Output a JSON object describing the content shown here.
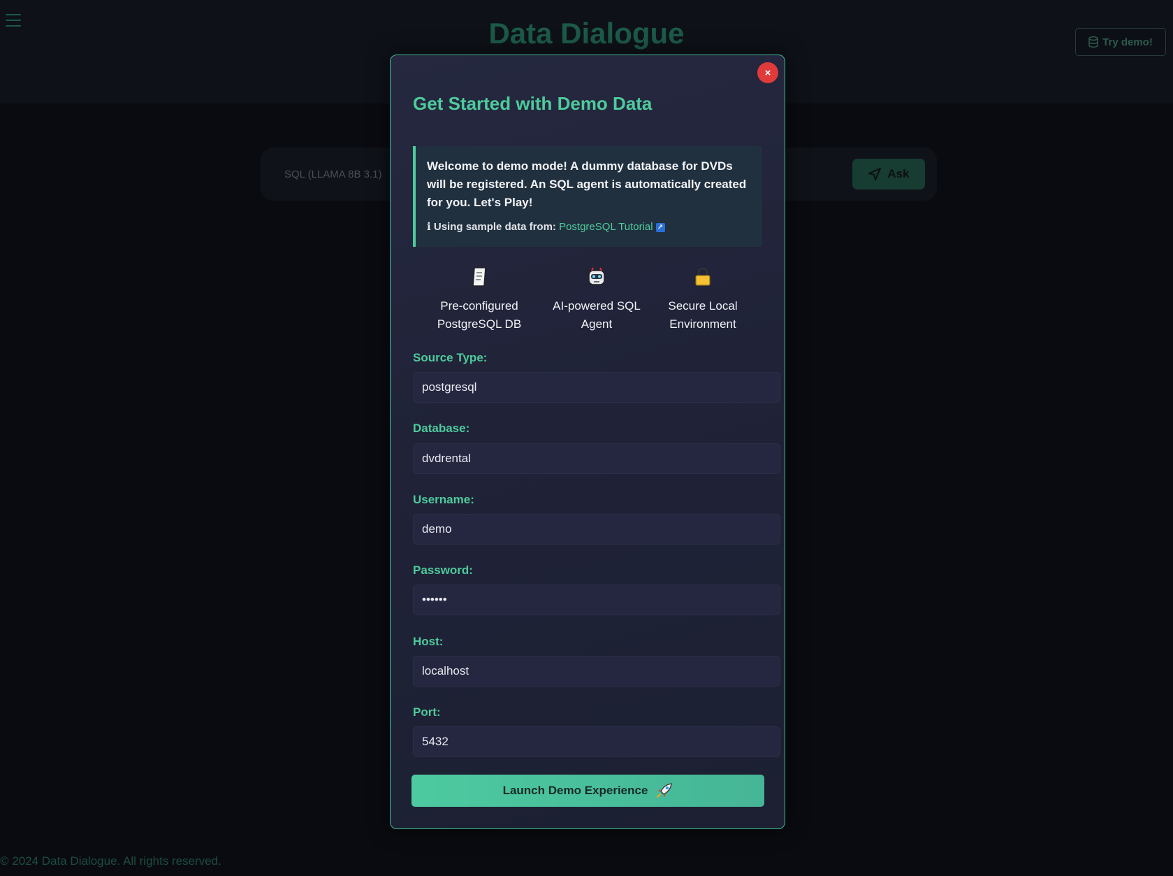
{
  "app": {
    "title": "Data Dialogue",
    "try_demo_label": "Try demo!",
    "query": {
      "placeholder": "SQL (LLAMA 8B 3.1)",
      "ask_label": "Ask"
    },
    "footer": "© 2024 Data Dialogue. All rights reserved."
  },
  "modal": {
    "title": "Get Started with Demo Data",
    "close_label": "×",
    "info": {
      "text": "Welcome to demo mode! A dummy database for DVDs will be registered. An SQL agent is automatically created for you. Let's Play!",
      "source_prefix": "ℹ Using sample data from:",
      "source_link": "PostgreSQL Tutorial",
      "ext_icon": "↗"
    },
    "features": [
      {
        "icon": "document-icon",
        "label": "Pre-configured PostgreSQL DB"
      },
      {
        "icon": "robot-icon",
        "label": "AI-powered SQL Agent"
      },
      {
        "icon": "lock-icon",
        "label": "Secure Local Environment"
      }
    ],
    "fields": {
      "source_type": {
        "label": "Source Type:",
        "value": "postgresql"
      },
      "database": {
        "label": "Database:",
        "value": "dvdrental"
      },
      "username": {
        "label": "Username:",
        "value": "demo"
      },
      "password": {
        "label": "Password:",
        "value": "demo12"
      },
      "host": {
        "label": "Host:",
        "value": "localhost"
      },
      "port": {
        "label": "Port:",
        "value": "5432"
      }
    },
    "launch_label": "Launch Demo Experience"
  },
  "colors": {
    "accent": "#4ecb9c",
    "close": "#e03a3a",
    "background": "#0a0b10",
    "modal": "#22253b"
  }
}
